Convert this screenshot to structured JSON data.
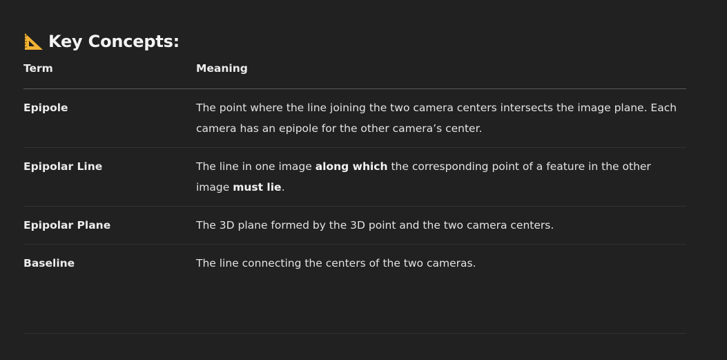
{
  "section": {
    "icon": "triangular-ruler-icon",
    "title": "Key Concepts:"
  },
  "table": {
    "headers": [
      "Term",
      "Meaning"
    ],
    "rows": [
      {
        "term": "Epipole",
        "meaning": "The point where the line joining the two camera centers intersects the image plane. Each camera has an epipole for the other camera’s center."
      },
      {
        "term": "Epipolar Line",
        "meaning_parts": [
          "The line in one image ",
          "along which",
          " the corresponding point of a feature in the other image ",
          "must lie",
          "."
        ]
      },
      {
        "term": "Epipolar Plane",
        "meaning": "The 3D plane formed by the 3D point and the two camera centers."
      },
      {
        "term": "Baseline",
        "meaning": "The line connecting the centers of the two cameras."
      }
    ]
  },
  "colors": {
    "background": "#212121",
    "text": "#ececec",
    "ruler": "#f2b233"
  }
}
